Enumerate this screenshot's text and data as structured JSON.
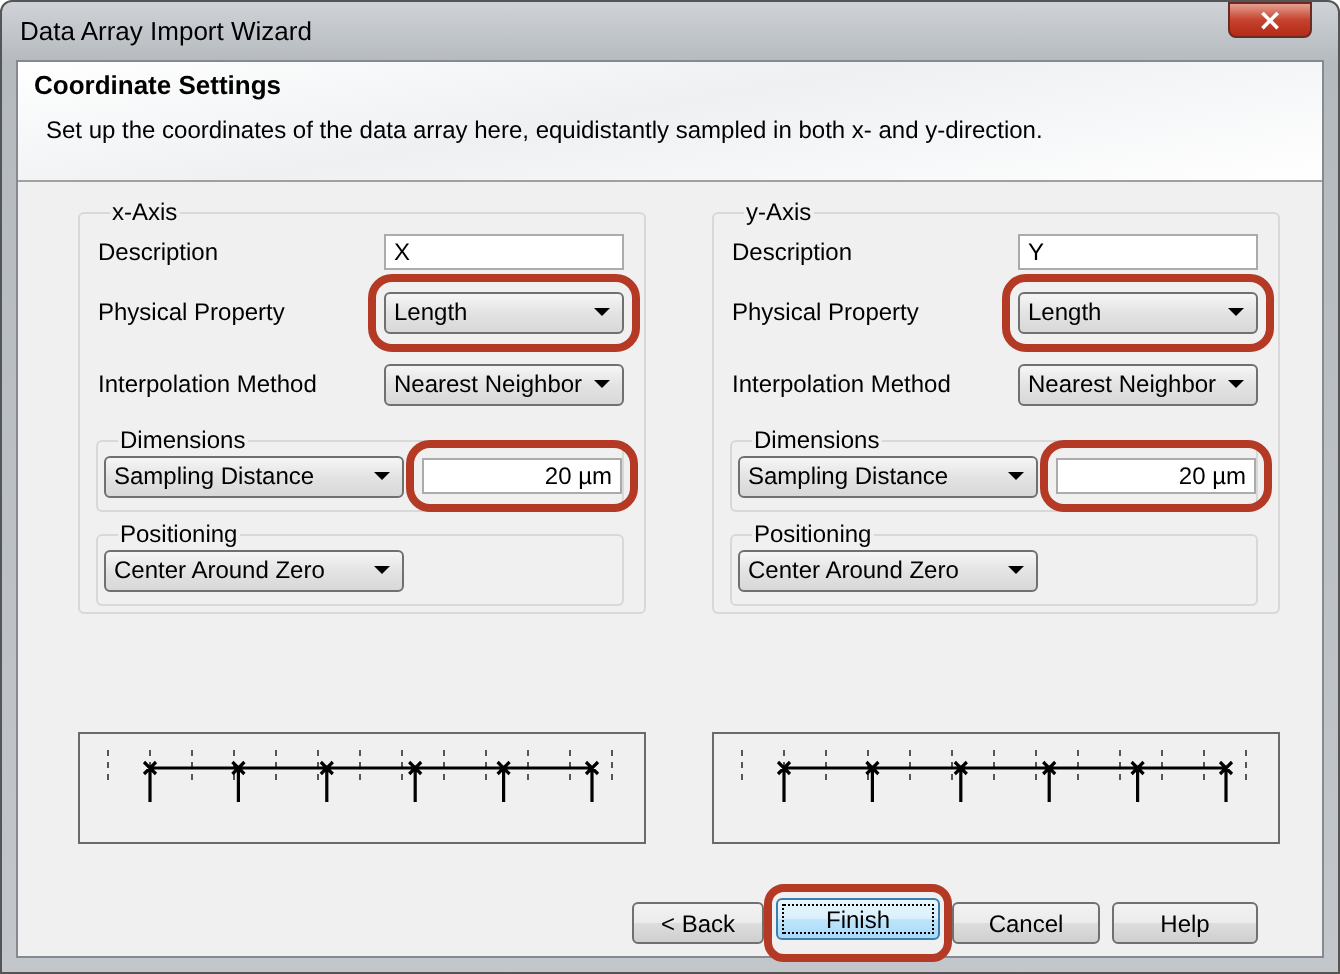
{
  "window": {
    "title": "Data Array Import Wizard",
    "close": "×"
  },
  "header": {
    "title": "Coordinate Settings",
    "subtitle": "Set up the coordinates of the data array here, equidistantly sampled in both x- and y-direction."
  },
  "axes": [
    {
      "legend": "x-Axis",
      "description_label": "Description",
      "description": "X",
      "property_label": "Physical Property",
      "property": "Length",
      "property_highlighted": true,
      "interpolation_label": "Interpolation Method",
      "interpolation": "Nearest Neighbor",
      "dimensions_legend": "Dimensions",
      "dimension_mode": "Sampling Distance",
      "dimension_value": "20 µm",
      "dimension_highlighted": true,
      "positioning_legend": "Positioning",
      "positioning": "Center Around Zero"
    },
    {
      "legend": "y-Axis",
      "description_label": "Description",
      "description": "Y",
      "property_label": "Physical Property",
      "property": "Length",
      "property_highlighted": true,
      "interpolation_label": "Interpolation Method",
      "interpolation": "Nearest Neighbor",
      "dimensions_legend": "Dimensions",
      "dimension_mode": "Sampling Distance",
      "dimension_value": "20 µm",
      "dimension_highlighted": true,
      "positioning_legend": "Positioning",
      "positioning": "Center Around Zero"
    }
  ],
  "buttons": [
    {
      "label": "< Back",
      "focused": false,
      "highlighted": false
    },
    {
      "label": "Finish",
      "focused": true,
      "highlighted": true
    },
    {
      "label": "Cancel",
      "focused": false,
      "highlighted": false
    },
    {
      "label": "Help",
      "focused": false,
      "highlighted": false
    }
  ]
}
